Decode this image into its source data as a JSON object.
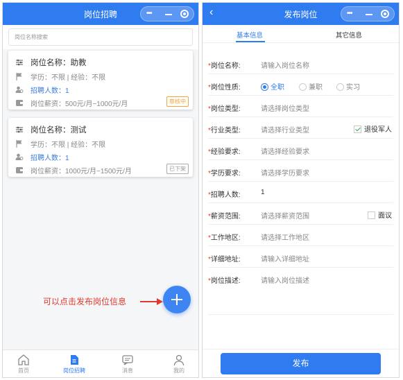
{
  "left": {
    "title": "岗位招聘",
    "search_placeholder": "岗位名称搜索",
    "jobs": [
      {
        "name": "岗位名称：助教",
        "requirements": "学历：不限 | 经验：不限",
        "headcount": "招聘人数：1",
        "salary": "岗位薪资：500元/月~1000元/月",
        "status": "审核中"
      },
      {
        "name": "岗位名称：测试",
        "requirements": "学历：不限 | 经验：不限",
        "headcount": "招聘人数：1",
        "salary": "岗位薪资：1000元/月~1500元/月",
        "status": "已下架"
      }
    ],
    "annotation": "可以点击发布岗位信息",
    "tabs": [
      {
        "label": "首页",
        "icon": "home-icon"
      },
      {
        "label": "岗位招聘",
        "icon": "document-icon"
      },
      {
        "label": "消息",
        "icon": "message-icon"
      },
      {
        "label": "我的",
        "icon": "user-icon"
      }
    ],
    "active_tab": "岗位招聘"
  },
  "right": {
    "title": "发布岗位",
    "tabs": [
      "基本信息",
      "其它信息"
    ],
    "form": {
      "job_name": {
        "label": "岗位名称:",
        "placeholder": "请输入岗位名称"
      },
      "job_nature": {
        "label": "岗位性质:",
        "options": [
          "全职",
          "兼职",
          "实习"
        ],
        "selected": "全职"
      },
      "job_type": {
        "label": "岗位类型:",
        "placeholder": "请选择岗位类型"
      },
      "industry": {
        "label": "行业类型:",
        "placeholder": "请选择行业类型",
        "checkbox": "退役军人"
      },
      "experience": {
        "label": "经验要求:",
        "placeholder": "请选择经验要求"
      },
      "education": {
        "label": "学历要求:",
        "placeholder": "请选择学历要求"
      },
      "headcount": {
        "label": "招聘人数:",
        "value": "1"
      },
      "salary": {
        "label": "薪资范围:",
        "placeholder": "请选择薪资范围",
        "checkbox": "面议"
      },
      "work_area": {
        "label": "工作地区:",
        "placeholder": "请选择工作地区"
      },
      "address": {
        "label": "详细地址:",
        "placeholder": "请输入详细地址"
      },
      "description": {
        "label": "岗位描述:",
        "placeholder": "请输入岗位描述"
      }
    },
    "submit_label": "发布"
  },
  "colors": {
    "primary": "#2f7bf0",
    "required": "#e03a2f",
    "pending": "#f0a43a"
  }
}
